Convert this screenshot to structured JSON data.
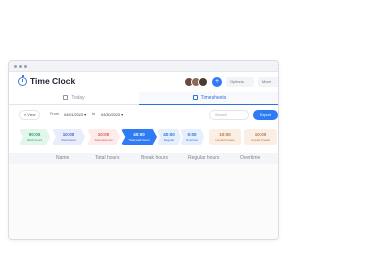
{
  "app": {
    "title": "Time Clock"
  },
  "header": {
    "add_label": "+",
    "options_label": "Options",
    "more_label": "More"
  },
  "tabs": [
    {
      "label": "Today"
    },
    {
      "label": "Timesheets"
    }
  ],
  "filters": {
    "view_label": "View",
    "from_label": "From",
    "from_date": "04/01/2023",
    "to_label": "to",
    "to_date": "04/30/2023",
    "search_placeholder": "Search",
    "export_label": "Export"
  },
  "stats": [
    {
      "value": "00:00",
      "label": "Work hours"
    },
    {
      "value": "10:00",
      "label": "Total hours"
    },
    {
      "value": "10:00",
      "label": "Total absence"
    },
    {
      "value": "40:00",
      "label": "Total paid hours"
    },
    {
      "value": "40:00",
      "label": "Regular"
    },
    {
      "value": "0:00",
      "label": "Overtime"
    },
    {
      "value": "10:00",
      "label": "Unpaid breaks"
    },
    {
      "value": "10:00",
      "label": "Unpaid breaks"
    }
  ],
  "colors": {
    "accent": "#2f7bf5"
  },
  "table": {
    "columns": [
      "Name",
      "Total hours",
      "Break hours",
      "Regular hours",
      "Overtime"
    ]
  }
}
